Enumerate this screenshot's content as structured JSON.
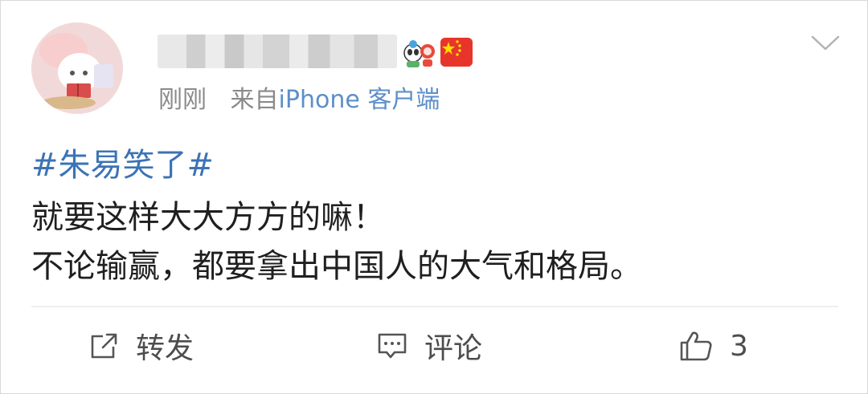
{
  "post": {
    "timestamp": "刚刚",
    "source_prefix": "来自",
    "source_app": "iPhone 客户端",
    "hashtag": "#朱易笑了#",
    "text_lines": [
      "就要这样大大方方的嘛！",
      "不论输赢，都要拿出中国人的大气和格局。"
    ]
  },
  "actions": {
    "repost_label": "转发",
    "comment_label": "评论",
    "like_count": "3"
  },
  "icons": {
    "menu": "chevron-down-icon",
    "repost": "repost-icon",
    "comment": "comment-icon",
    "like": "thumbs-up-icon"
  },
  "colors": {
    "hashtag": "#3b73b5",
    "meta_text": "#8a8a8a",
    "body_text": "#1f1f1f",
    "flag_red": "#e8352c",
    "flag_star": "#ffde00"
  }
}
